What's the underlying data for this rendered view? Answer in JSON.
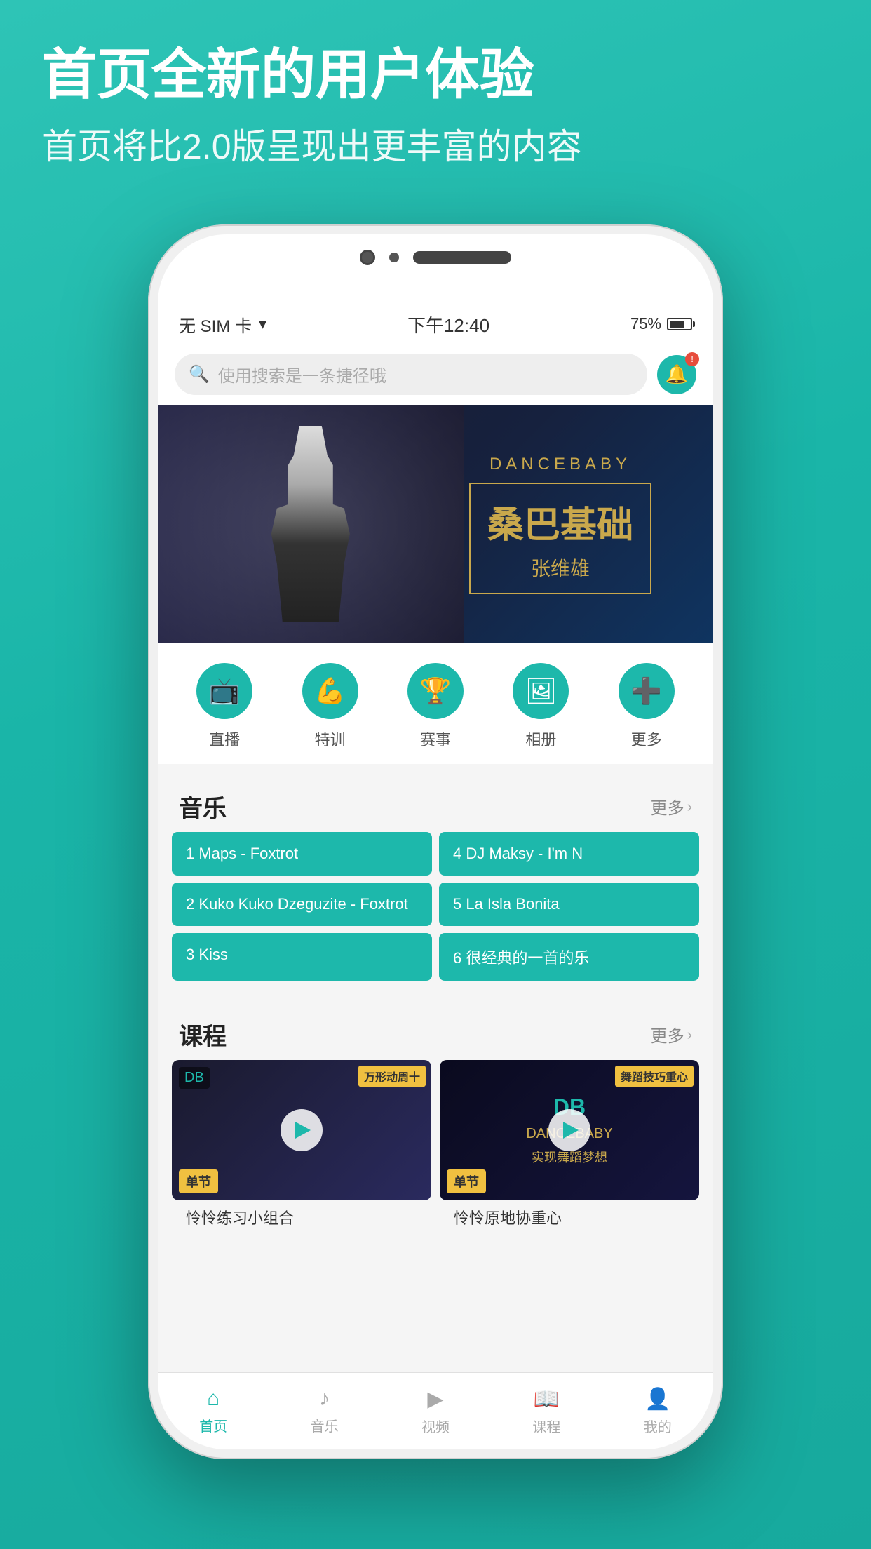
{
  "hero": {
    "title": "首页全新的用户体验",
    "subtitle": "首页将比2.0版呈现出更丰富的内容"
  },
  "statusBar": {
    "carrier": "无 SIM 卡",
    "wifi": "WiFi",
    "time": "下午12:40",
    "battery_pct": "75%"
  },
  "searchBar": {
    "placeholder": "使用搜索是一条捷径哦"
  },
  "banner": {
    "brand": "DANCEBABY",
    "title": "桑巴基础",
    "instructor": "张维雄"
  },
  "categories": [
    {
      "id": "live",
      "label": "直播",
      "icon": "📺"
    },
    {
      "id": "training",
      "label": "特训",
      "icon": "💪"
    },
    {
      "id": "competition",
      "label": "赛事",
      "icon": "🏆"
    },
    {
      "id": "album",
      "label": "相册",
      "icon": "🖼"
    },
    {
      "id": "more",
      "label": "更多",
      "icon": "➕"
    }
  ],
  "musicSection": {
    "title": "音乐",
    "more": "更多",
    "items": [
      {
        "id": 1,
        "text": "1 Maps - Foxtrot"
      },
      {
        "id": 4,
        "text": "4 DJ Maksy - I'm N"
      },
      {
        "id": 2,
        "text": "2 Kuko Kuko Dzeguzite - Foxtrot"
      },
      {
        "id": 5,
        "text": "5 La Isla Bonita"
      },
      {
        "id": 3,
        "text": "3 Kiss"
      },
      {
        "id": 6,
        "text": "6 很经典的一首的乐"
      }
    ]
  },
  "courseSection": {
    "title": "课程",
    "more": "更多",
    "items": [
      {
        "id": 1,
        "badge": "单节",
        "topbar": "万形动周十",
        "title": "怜怜练习小组合"
      },
      {
        "id": 2,
        "badge": "单节",
        "topbar": "舞蹈技巧重心",
        "title": "怜怜原地协重心"
      }
    ]
  },
  "bottomNav": [
    {
      "id": "home",
      "label": "首页",
      "icon": "🏠",
      "active": true
    },
    {
      "id": "music",
      "label": "音乐",
      "icon": "🎵",
      "active": false
    },
    {
      "id": "video",
      "label": "视频",
      "icon": "▶",
      "active": false
    },
    {
      "id": "course",
      "label": "课程",
      "icon": "📖",
      "active": false
    },
    {
      "id": "mine",
      "label": "我的",
      "icon": "👤",
      "active": false
    }
  ]
}
